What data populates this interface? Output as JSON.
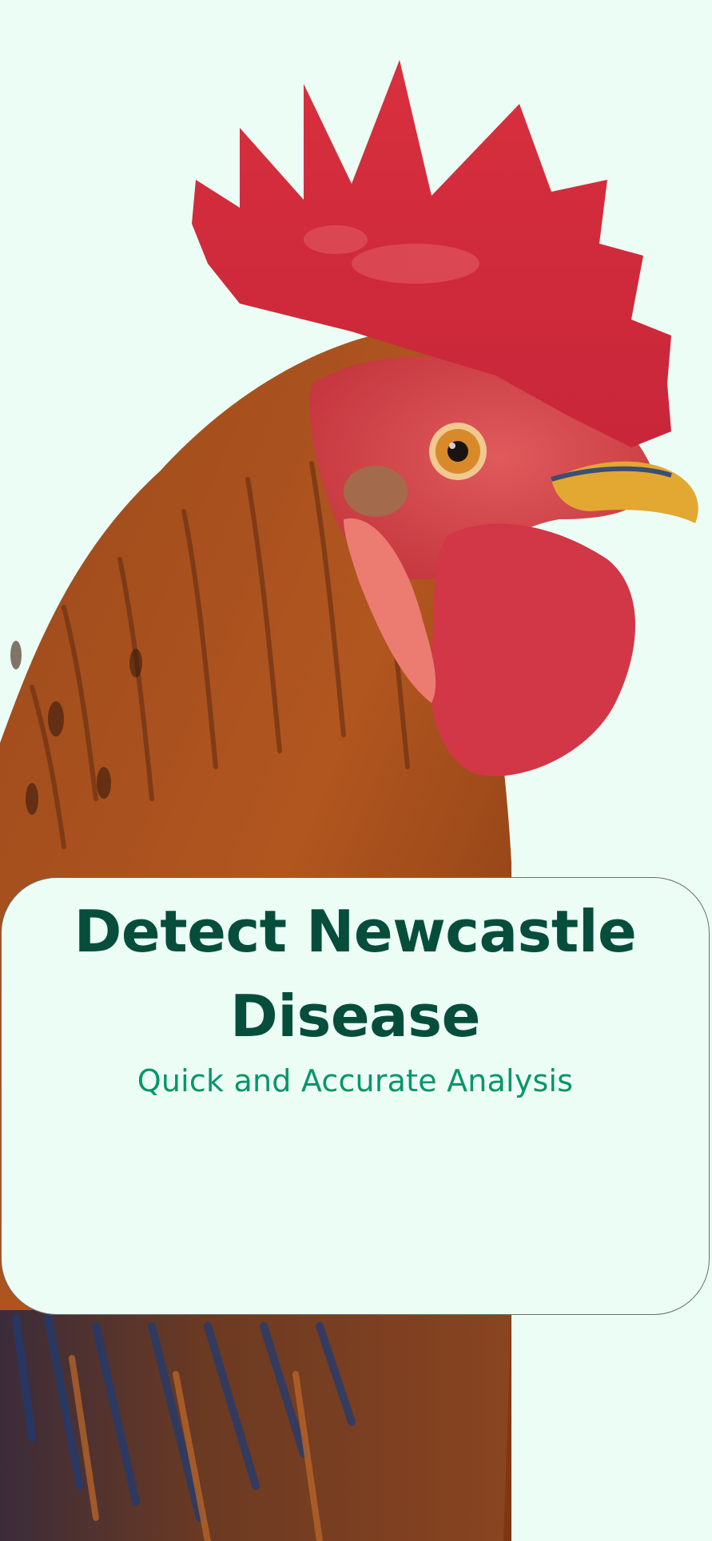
{
  "hero": {
    "image": "rooster-head-photo"
  },
  "card": {
    "title": "Detect Newcastle Disease",
    "subtitle": "Quick and Accurate Analysis"
  },
  "colors": {
    "background": "#ecfdf5",
    "title": "#064e3b",
    "subtitle": "#059669",
    "card_border": "#6b6f70"
  }
}
